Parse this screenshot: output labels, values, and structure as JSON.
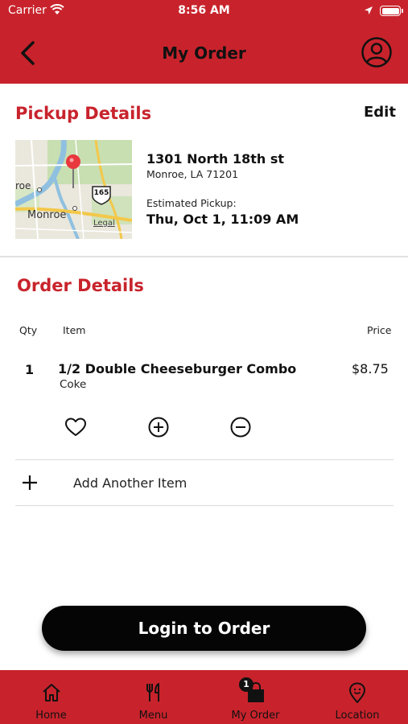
{
  "status_bar": {
    "carrier": "Carrier",
    "time": "8:56 AM"
  },
  "header": {
    "title": "My Order"
  },
  "pickup": {
    "title": "Pickup Details",
    "edit_label": "Edit",
    "address_line1": "1301 North 18th st",
    "address_line2": "Monroe, LA 71201",
    "estimated_label": "Estimated Pickup:",
    "estimated_time": "Thu, Oct 1, 11:09 AM",
    "map": {
      "city_label": "Monroe",
      "city_label_partial": "roe",
      "highway_shield": "165",
      "legal_label": "Legal"
    }
  },
  "order": {
    "title": "Order Details",
    "columns": {
      "qty": "Qty",
      "item": "Item",
      "price": "Price"
    },
    "items": [
      {
        "qty": "1",
        "name": "1/2 Double Cheeseburger Combo",
        "modifier": "Coke",
        "price": "$8.75"
      }
    ],
    "add_item_label": "Add Another Item"
  },
  "login_button": {
    "label": "Login to Order"
  },
  "tab_bar": {
    "tabs": [
      {
        "label": "Home",
        "icon": "home-icon"
      },
      {
        "label": "Menu",
        "icon": "fork-knife-icon"
      },
      {
        "label": "My Order",
        "icon": "shopping-bag-icon",
        "badge": "1"
      },
      {
        "label": "Location",
        "icon": "location-pin-icon"
      }
    ]
  },
  "colors": {
    "brand_red": "#c8232c",
    "button_black": "#050505",
    "map_pin": "#e8383d"
  }
}
